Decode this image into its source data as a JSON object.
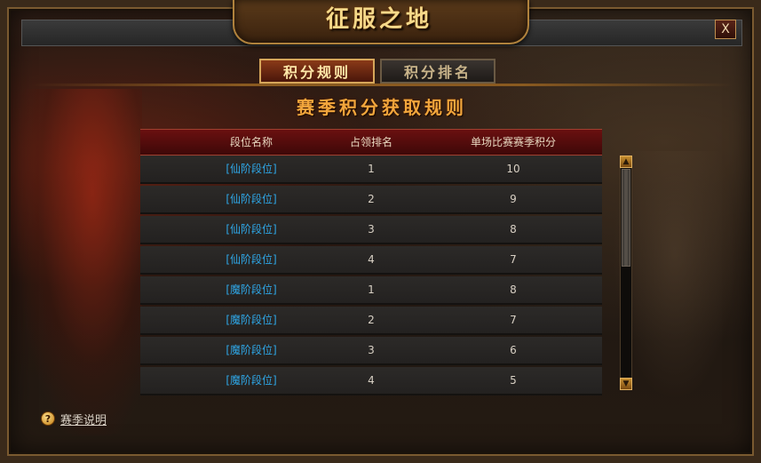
{
  "window": {
    "title": "征服之地",
    "close_label": "X"
  },
  "tabs": [
    {
      "label": "积分规则",
      "active": true
    },
    {
      "label": "积分排名",
      "active": false
    }
  ],
  "section_title": "赛季积分获取规则",
  "table": {
    "headers": [
      "段位名称",
      "占领排名",
      "单场比赛赛季积分"
    ],
    "rows": [
      {
        "tier": "[仙阶段位]",
        "rank": "1",
        "points": "10"
      },
      {
        "tier": "[仙阶段位]",
        "rank": "2",
        "points": "9"
      },
      {
        "tier": "[仙阶段位]",
        "rank": "3",
        "points": "8"
      },
      {
        "tier": "[仙阶段位]",
        "rank": "4",
        "points": "7"
      },
      {
        "tier": "[魔阶段位]",
        "rank": "1",
        "points": "8"
      },
      {
        "tier": "[魔阶段位]",
        "rank": "2",
        "points": "7"
      },
      {
        "tier": "[魔阶段位]",
        "rank": "3",
        "points": "6"
      },
      {
        "tier": "[魔阶段位]",
        "rank": "4",
        "points": "5"
      }
    ]
  },
  "scrollbar": {
    "up_icon": "arrow-up-icon",
    "down_icon": "arrow-down-icon"
  },
  "help": {
    "icon": "question-icon",
    "label": "赛季说明"
  },
  "colors": {
    "tier_link": "#2ea6e6",
    "title_gold": "#f5d98a",
    "section_orange": "#f2a63c",
    "header_red": "#6a1010"
  }
}
